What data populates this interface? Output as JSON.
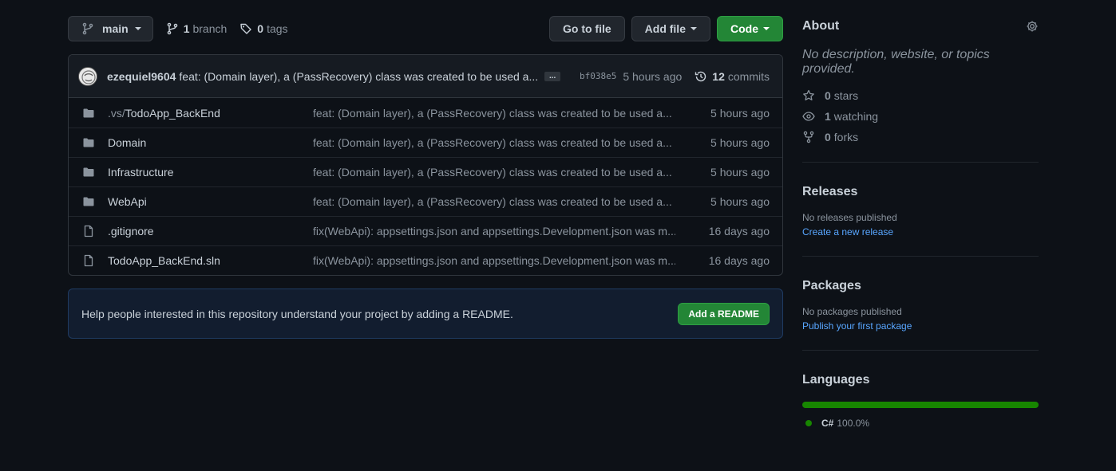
{
  "repo": {
    "branch_name": "main",
    "branch_count": "1",
    "branch_label": "branch",
    "tag_count": "0",
    "tag_label": "tags",
    "go_to_file": "Go to file",
    "add_file": "Add file",
    "code": "Code"
  },
  "latest_commit": {
    "author": "ezequiel9604",
    "message": "feat: (Domain layer), a (PassRecovery) class was created to be used a...",
    "ellipsis": "...",
    "sha": "bf038e5",
    "age": "5 hours ago",
    "commit_count": "12",
    "commit_label": "commits"
  },
  "files": [
    {
      "prefix": ".vs/",
      "name": "TodoApp_BackEnd",
      "type": "folder",
      "message": "feat: (Domain layer), a (PassRecovery) class was created to be used a...",
      "age": "5 hours ago"
    },
    {
      "prefix": "",
      "name": "Domain",
      "type": "folder",
      "message": "feat: (Domain layer), a (PassRecovery) class was created to be used a...",
      "age": "5 hours ago"
    },
    {
      "prefix": "",
      "name": "Infrastructure",
      "type": "folder",
      "message": "feat: (Domain layer), a (PassRecovery) class was created to be used a...",
      "age": "5 hours ago"
    },
    {
      "prefix": "",
      "name": "WebApi",
      "type": "folder",
      "message": "feat: (Domain layer), a (PassRecovery) class was created to be used a...",
      "age": "5 hours ago"
    },
    {
      "prefix": "",
      "name": ".gitignore",
      "type": "file",
      "message": "fix(WebApi): appsettings.json and appsettings.Development.json was m...",
      "age": "16 days ago"
    },
    {
      "prefix": "",
      "name": "TodoApp_BackEnd.sln",
      "type": "file",
      "message": "fix(WebApi): appsettings.json and appsettings.Development.json was m...",
      "age": "16 days ago"
    }
  ],
  "readme_banner": {
    "text": "Help people interested in this repository understand your project by adding a README.",
    "button": "Add a README"
  },
  "sidebar": {
    "about_title": "About",
    "about_description": "No description, website, or topics provided.",
    "stars_count": "0",
    "stars_label": "stars",
    "watching_count": "1",
    "watching_label": "watching",
    "forks_count": "0",
    "forks_label": "forks",
    "releases_title": "Releases",
    "releases_text": "No releases published",
    "releases_link": "Create a new release",
    "packages_title": "Packages",
    "packages_text": "No packages published",
    "packages_link": "Publish your first package",
    "languages_title": "Languages",
    "languages": [
      {
        "name": "C#",
        "percent_label": "100.0%",
        "percent": 100.0,
        "color": "#178600"
      }
    ]
  },
  "colors": {
    "background": "#0d1117",
    "accent_green": "#238636",
    "link_blue": "#58a6ff",
    "csharp": "#178600"
  }
}
